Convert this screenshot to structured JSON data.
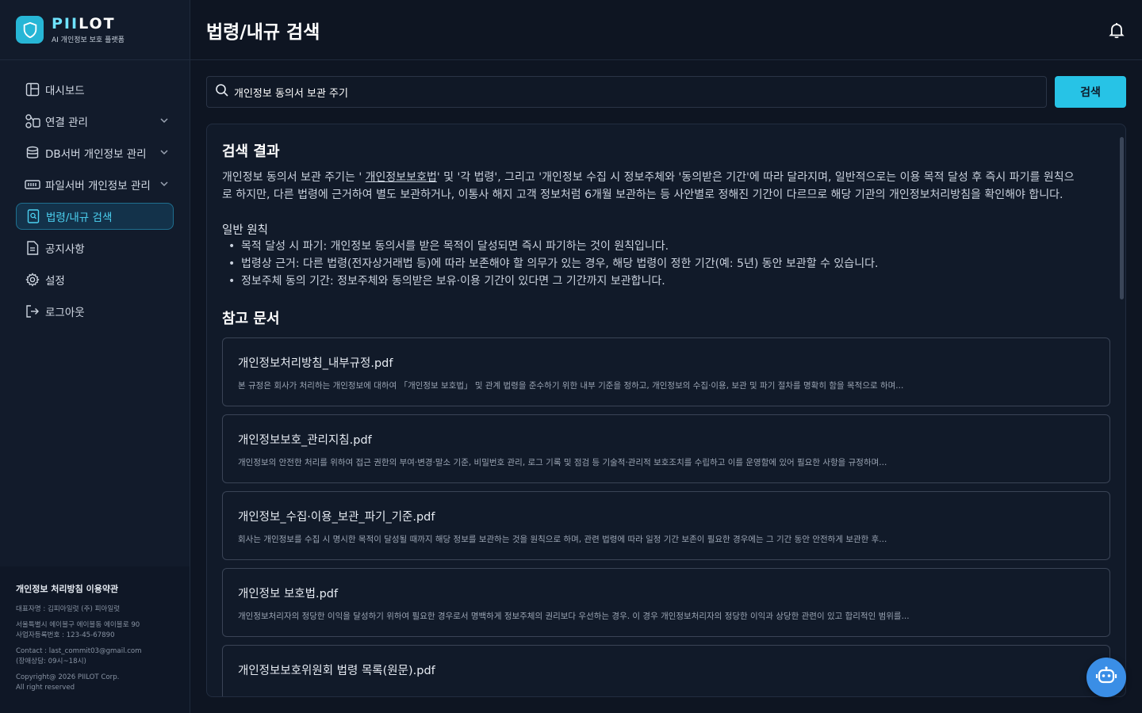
{
  "brand": {
    "name_accent": "PII",
    "name_rest": "LOT",
    "subtitle": "AI 개인정보 보호 플랫폼"
  },
  "sidebar": {
    "items": [
      {
        "label": "대시보드",
        "icon": "dashboard-icon",
        "expandable": false
      },
      {
        "label": "연결 관리",
        "icon": "connection-icon",
        "expandable": true
      },
      {
        "label": "DB서버 개인정보 관리",
        "icon": "database-icon",
        "expandable": true
      },
      {
        "label": "파일서버 개인정보 관리",
        "icon": "file-server-icon",
        "expandable": true
      },
      {
        "label": "법령/내규 검색",
        "icon": "document-search-icon",
        "expandable": false,
        "active": true
      },
      {
        "label": "공지사항",
        "icon": "notice-icon",
        "expandable": false
      },
      {
        "label": "설정",
        "icon": "gear-icon",
        "expandable": false
      },
      {
        "label": "로그아웃",
        "icon": "logout-icon",
        "expandable": false
      }
    ],
    "footer": {
      "title": "개인정보 처리방침  이용약관",
      "ceo": "대표자명 : 김피아일럿  (주) 피아일럿",
      "address": "서울특별시 에이블구 에이블동 에이블로 90",
      "biz_no": "사업자등록번호 : 123-45-67890",
      "contact": "Contact : last_commit03@gmail.com",
      "hours": "(장애상담:  09시~18시)",
      "copyright": "Copyright@ 2026 PIILOT Corp.",
      "rights": "All right reserved"
    }
  },
  "header": {
    "title": "법령/내규 검색"
  },
  "search": {
    "value": "개인정보 동의서 보관 주기",
    "button_label": "검색"
  },
  "result": {
    "title": "검색 결과",
    "answer_pre": "개인정보 동의서 보관 주기는 ' ",
    "answer_link": "개인정보보호법",
    "answer_post": "' 및 '각 법령', 그리고 '개인정보 수집 시 정보주체와 '동의받은 기간'에 따라 달라지며, 일반적으로는 이용 목적 달성 후 즉시 파기를 원칙으로 하지만, 다른 법령에 근거하여 별도 보관하거나, 이통사 해지 고객 정보처럼 6개월 보관하는 등 사안별로 정해진 기간이 다르므로 해당 기관의 개인정보처리방침을 확인해야 합니다.",
    "principle_title": "일반 원칙",
    "bullets": [
      "목적 달성 시 파기: 개인정보 동의서를 받은 목적이 달성되면 즉시 파기하는 것이 원칙입니다.",
      "법령상 근거: 다른 법령(전자상거래법 등)에 따라 보존해야 할 의무가 있는 경우, 해당 법령이 정한 기간(예: 5년) 동안 보관할 수 있습니다.",
      "정보주체 동의 기간: 정보주체와 동의받은 보유·이용 기간이 있다면 그 기간까지 보관합니다."
    ]
  },
  "references": {
    "title": "참고 문서",
    "docs": [
      {
        "name": "개인정보처리방침_내부규정.pdf",
        "excerpt": "본 규정은 회사가 처리하는 개인정보에 대하여 「개인정보 보호법」 및 관계 법령을 준수하기 위한 내부 기준을 정하고, 개인정보의 수집·이용, 보관 및 파기 절차를 명확히 함을 목적으로 하며..."
      },
      {
        "name": "개인정보보호_관리지침.pdf",
        "excerpt": "개인정보의 안전한 처리를 위하여 접근 권한의 부여·변경·말소 기준, 비밀번호 관리, 로그 기록 및 점검 등 기술적·관리적 보호조치를 수립하고 이를 운영함에 있어 필요한 사항을 규정하며..."
      },
      {
        "name": "개인정보_수집·이용_보관_파기_기준.pdf",
        "excerpt": "회사는 개인정보를 수집 시 명시한 목적이 달성될 때까지 해당 정보를 보관하는 것을 원칙으로 하며, 관련 법령에 따라 일정 기간 보존이 필요한 경우에는 그 기간 동안 안전하게 보관한 후..."
      },
      {
        "name": "개인정보 보호법.pdf",
        "excerpt": "개인정보처리자의 정당한 이익을 달성하기 위하여 필요한 경우로서 명백하게 정보주체의 권리보다 우선하는 경우. 이 경우 개인정보처리자의 정당한 이익과 상당한 관련이 있고 합리적인 범위를..."
      },
      {
        "name": "개인정보보호위원회 법령 목록(원문).pdf",
        "excerpt": ""
      }
    ]
  },
  "colors": {
    "accent": "#27c3e6",
    "background": "#0e1522",
    "sidebar": "#121b2b"
  }
}
